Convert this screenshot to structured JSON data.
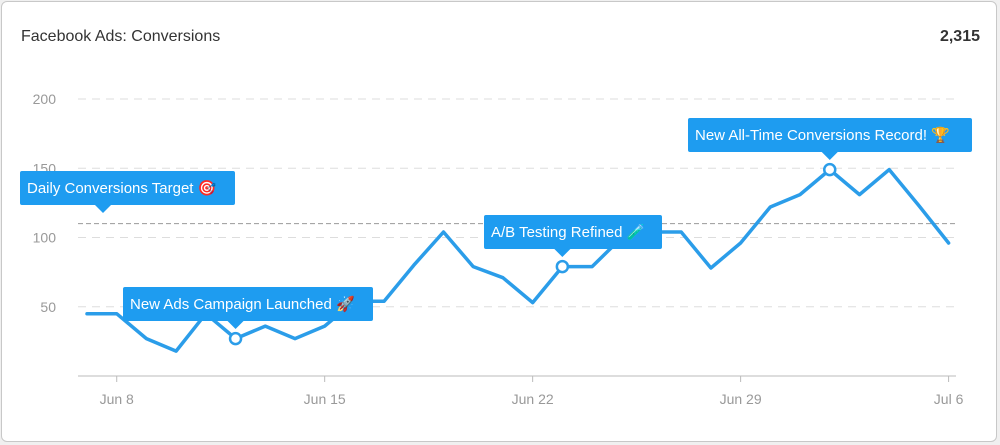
{
  "header": {
    "title": "Facebook Ads: Conversions",
    "total": "2,315"
  },
  "colors": {
    "line": "#2b9de9",
    "callout": "#1e9cf0",
    "grid": "#dddddd",
    "target": "#999999"
  },
  "chart_data": {
    "type": "line",
    "title": "Facebook Ads: Conversions",
    "xlabel": "",
    "ylabel": "",
    "x_start": "2024-06-07",
    "x_ticks": [
      {
        "label": "Jun 8",
        "date": "2024-06-08"
      },
      {
        "label": "Jun 15",
        "date": "2024-06-15"
      },
      {
        "label": "Jun 22",
        "date": "2024-06-22"
      },
      {
        "label": "Jun 29",
        "date": "2024-06-29"
      },
      {
        "label": "Jul 6",
        "date": "2024-07-06"
      }
    ],
    "y_ticks": [
      50,
      100,
      150,
      200
    ],
    "ylim": [
      0,
      200
    ],
    "grid": true,
    "target_line": {
      "value": 110,
      "label": "Daily Conversions Target",
      "icon": "🎯"
    },
    "series": [
      {
        "name": "",
        "values": [
          [
            "2024-06-07",
            45
          ],
          [
            "2024-06-08",
            45
          ],
          [
            "2024-06-09",
            27
          ],
          [
            "2024-06-10",
            18
          ],
          [
            "2024-06-11",
            45
          ],
          [
            "2024-06-12",
            27
          ],
          [
            "2024-06-13",
            36
          ],
          [
            "2024-06-14",
            27
          ],
          [
            "2024-06-15",
            36
          ],
          [
            "2024-06-16",
            54
          ],
          [
            "2024-06-17",
            54
          ],
          [
            "2024-06-18",
            80
          ],
          [
            "2024-06-19",
            104
          ],
          [
            "2024-06-20",
            79
          ],
          [
            "2024-06-21",
            71
          ],
          [
            "2024-06-22",
            53
          ],
          [
            "2024-06-23",
            79
          ],
          [
            "2024-06-24",
            79
          ],
          [
            "2024-06-25",
            100
          ],
          [
            "2024-06-26",
            104
          ],
          [
            "2024-06-27",
            104
          ],
          [
            "2024-06-28",
            78
          ],
          [
            "2024-06-29",
            96
          ],
          [
            "2024-06-30",
            122
          ],
          [
            "2024-07-01",
            131
          ],
          [
            "2024-07-02",
            149
          ],
          [
            "2024-07-03",
            131
          ],
          [
            "2024-07-04",
            149
          ],
          [
            "2024-07-05",
            123
          ],
          [
            "2024-07-06",
            96
          ]
        ]
      }
    ],
    "annotations": [
      {
        "date": "2024-06-12",
        "value": 27,
        "label": "New Ads Campaign Launched",
        "icon": "🚀"
      },
      {
        "date": "2024-06-23",
        "value": 79,
        "label": "A/B Testing Refined",
        "icon": "🧪"
      },
      {
        "date": "2024-07-02",
        "value": 149,
        "label": "New All-Time Conversions Record!",
        "icon": "🏆"
      }
    ]
  }
}
